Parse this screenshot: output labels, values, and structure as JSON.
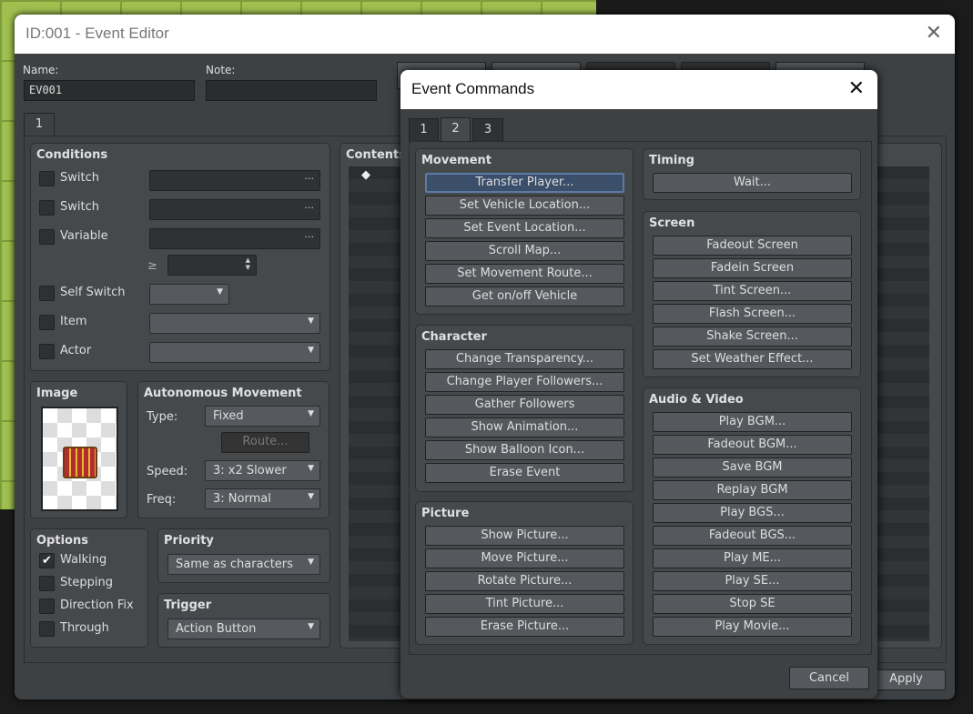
{
  "editor": {
    "title": "ID:001 - Event Editor",
    "name_label": "Name:",
    "name_value": "EV001",
    "note_label": "Note:",
    "note_value": "",
    "page_tab": "1",
    "conditions": {
      "title": "Conditions",
      "rows": [
        {
          "label": "Switch",
          "checked": false
        },
        {
          "label": "Switch",
          "checked": false
        },
        {
          "label": "Variable",
          "checked": false
        },
        {
          "label": "Self Switch",
          "checked": false
        },
        {
          "label": "Item",
          "checked": false
        },
        {
          "label": "Actor",
          "checked": false
        }
      ],
      "ge_symbol": "≥"
    },
    "contents": {
      "title": "Contents",
      "first_item": "◆"
    },
    "image": {
      "title": "Image"
    },
    "autonomous": {
      "title": "Autonomous Movement",
      "type_label": "Type:",
      "type_value": "Fixed",
      "route_button": "Route...",
      "speed_label": "Speed:",
      "speed_value": "3: x2 Slower",
      "freq_label": "Freq:",
      "freq_value": "3: Normal"
    },
    "options": {
      "title": "Options",
      "items": [
        {
          "label": "Walking",
          "checked": true
        },
        {
          "label": "Stepping",
          "checked": false
        },
        {
          "label": "Direction Fix",
          "checked": false
        },
        {
          "label": "Through",
          "checked": false
        }
      ]
    },
    "priority": {
      "title": "Priority",
      "value": "Same as characters"
    },
    "trigger": {
      "title": "Trigger",
      "value": "Action Button"
    },
    "cancel": "Cancel",
    "apply": "Apply"
  },
  "dialog": {
    "title": "Event Commands",
    "tabs": [
      "1",
      "2",
      "3"
    ],
    "active_tab": "2",
    "cancel": "Cancel",
    "groups": [
      {
        "title": "Movement",
        "buttons": [
          "Transfer Player...",
          "Set Vehicle Location...",
          "Set Event Location...",
          "Scroll Map...",
          "Set Movement Route...",
          "Get on/off Vehicle"
        ]
      },
      {
        "title": "Character",
        "buttons": [
          "Change Transparency...",
          "Change Player Followers...",
          "Gather Followers",
          "Show Animation...",
          "Show Balloon Icon...",
          "Erase Event"
        ]
      },
      {
        "title": "Picture",
        "buttons": [
          "Show Picture...",
          "Move Picture...",
          "Rotate Picture...",
          "Tint Picture...",
          "Erase Picture..."
        ]
      },
      {
        "title": "Timing",
        "buttons": [
          "Wait..."
        ]
      },
      {
        "title": "Screen",
        "buttons": [
          "Fadeout Screen",
          "Fadein Screen",
          "Tint Screen...",
          "Flash Screen...",
          "Shake Screen...",
          "Set Weather Effect..."
        ]
      },
      {
        "title": "Audio & Video",
        "buttons": [
          "Play BGM...",
          "Fadeout BGM...",
          "Save BGM",
          "Replay BGM",
          "Play BGS...",
          "Fadeout BGS...",
          "Play ME...",
          "Play SE...",
          "Stop SE",
          "Play Movie..."
        ]
      }
    ]
  }
}
